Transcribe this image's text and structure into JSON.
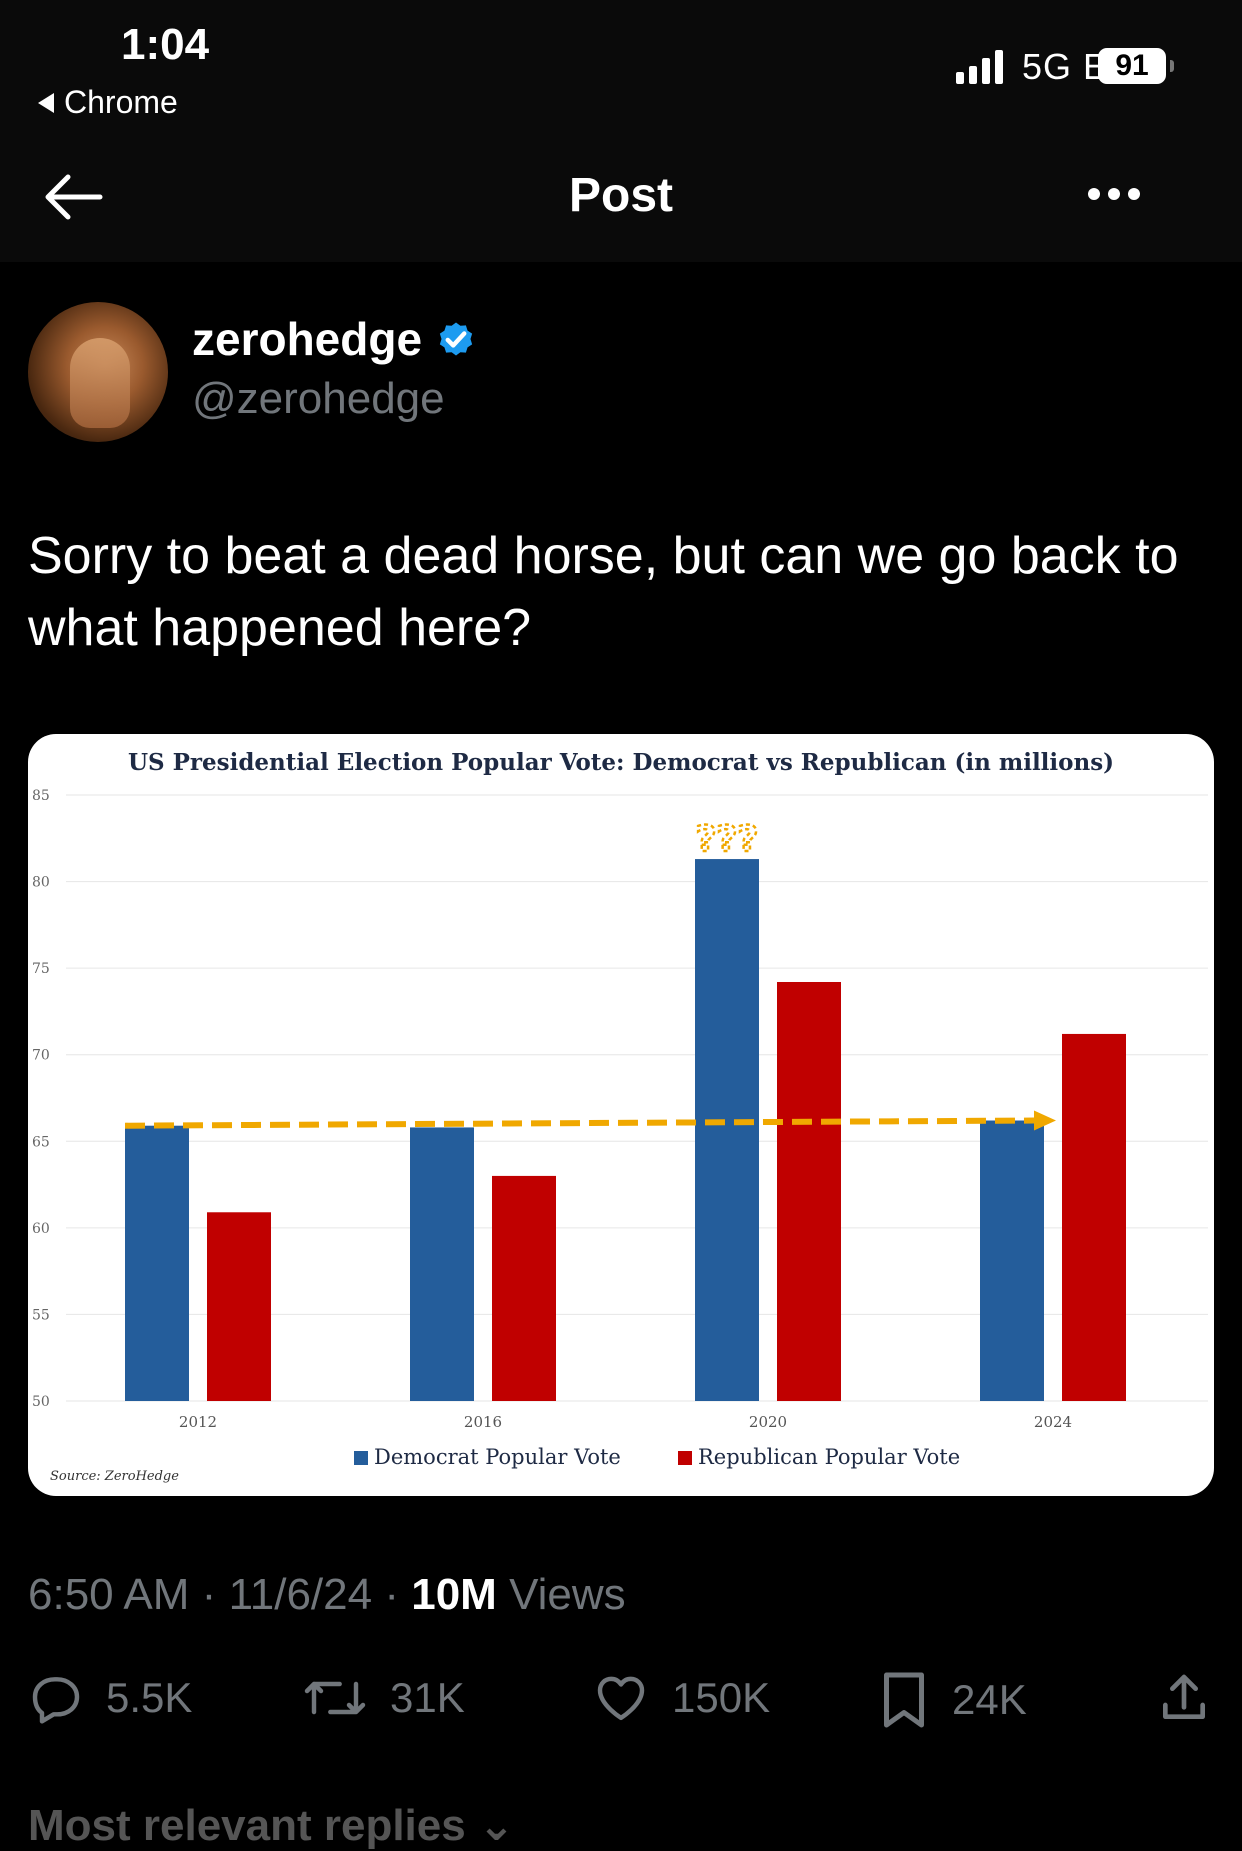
{
  "status_bar": {
    "time": "1:04",
    "back_app": "Chrome",
    "network": "5G E",
    "battery": "91"
  },
  "nav": {
    "title": "Post",
    "back_icon": "arrow-left-icon",
    "more_icon": "ellipsis-icon"
  },
  "author": {
    "name": "zerohedge",
    "handle": "@zerohedge",
    "verified": true,
    "verified_color": "#1d9bf0"
  },
  "tweet": {
    "text": "Sorry to beat a dead horse, but can we go back to what happened here?"
  },
  "meta": {
    "time": "6:50 AM",
    "date": "11/6/24",
    "views_count": "10M",
    "views_label": "Views"
  },
  "actions": {
    "replies": "5.5K",
    "reposts": "31K",
    "likes": "150K",
    "bookmarks": "24K"
  },
  "replies_section": {
    "label": "Most relevant replies"
  },
  "colors": {
    "democrat": "#245d9b",
    "republican": "#c00000",
    "annotation": "#f0a800"
  },
  "chart_data": {
    "type": "bar",
    "title": "US Presidential Election Popular Vote: Democrat vs Republican (in millions)",
    "categories": [
      "2012",
      "2016",
      "2020",
      "2024"
    ],
    "series": [
      {
        "name": "Democrat Popular Vote",
        "values": [
          65.9,
          65.8,
          81.3,
          66.2
        ]
      },
      {
        "name": "Republican Popular Vote",
        "values": [
          60.9,
          63.0,
          74.2,
          71.2
        ]
      }
    ],
    "ylim": [
      50,
      85
    ],
    "yticks": [
      "50",
      "55",
      "60",
      "65",
      "70",
      "75",
      "80",
      "85"
    ],
    "grid": true,
    "legend_position": "bottom",
    "annotation": "???",
    "source": "Source: ZeroHedge"
  }
}
